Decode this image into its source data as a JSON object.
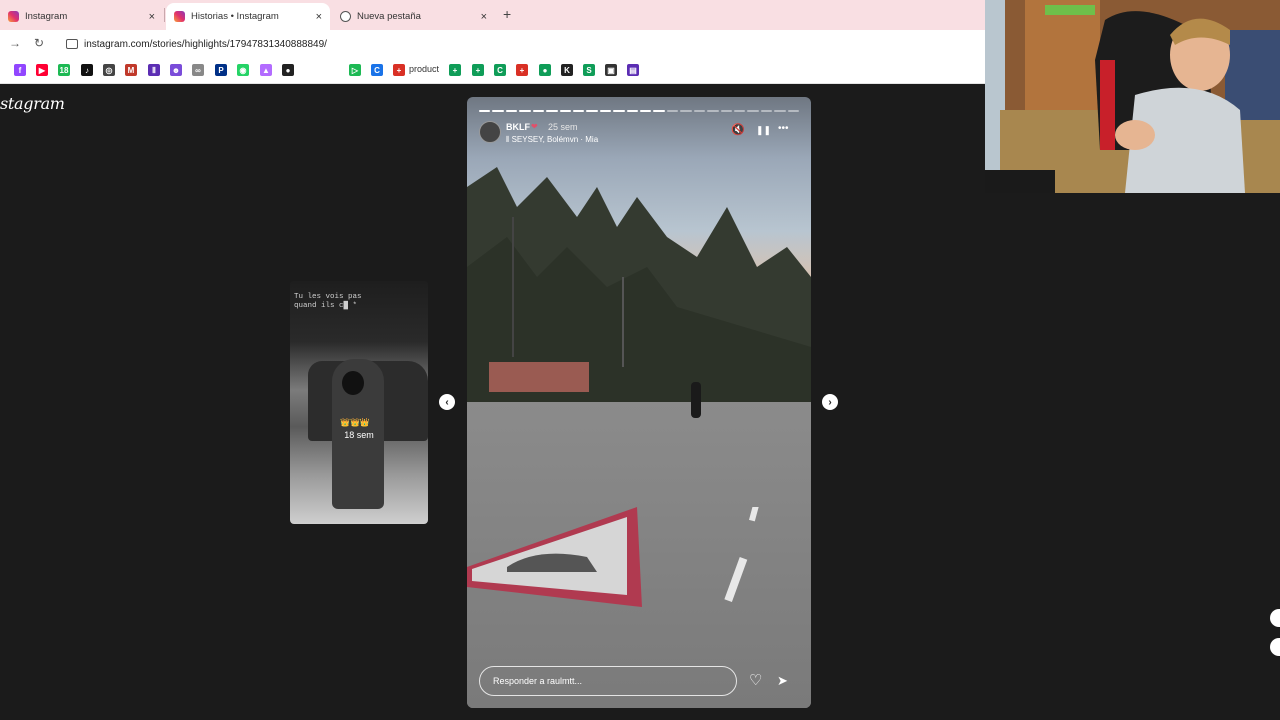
{
  "browser": {
    "tabs": [
      {
        "title": "Instagram",
        "favicon": "instagram-icon",
        "active": false
      },
      {
        "title": "Historias • Instagram",
        "favicon": "instagram-icon",
        "active": true
      },
      {
        "title": "Nueva pestaña",
        "favicon": "globe-icon",
        "active": false
      }
    ],
    "close_glyph": "×",
    "new_tab_glyph": "+",
    "url": "instagram.com/stories/highlights/17947831340888849/",
    "bookmark_text": "product",
    "bookmark_letters": [
      "f",
      "▶",
      "18",
      "♪",
      "◎",
      "M",
      "Ⅱ",
      "☻",
      "∞",
      "P",
      "◉",
      "▲",
      "●",
      "●",
      "▷",
      "C",
      "+",
      "+",
      "+",
      "C",
      "+",
      "●",
      "K",
      "S",
      "▣",
      "▤"
    ]
  },
  "instagram": {
    "logo": "stagram",
    "prev_story": {
      "caption": "Tu les vois pas\nquand ils c█ *",
      "emojis": "👑👑👑",
      "age": "18 sem"
    },
    "story": {
      "username": "BKLF",
      "badge": "❤",
      "age": "25 sem",
      "music": "⫴ SEYSEY, Bolémvn · Mia",
      "progress_total": 24,
      "progress_done": 14,
      "reply_placeholder": "Responder a raulmtt..."
    },
    "icons": {
      "mute": "🔇",
      "pause": "❚❚",
      "more": "•••",
      "prev": "‹",
      "next": "›",
      "like": "♡",
      "share": "➤"
    }
  }
}
